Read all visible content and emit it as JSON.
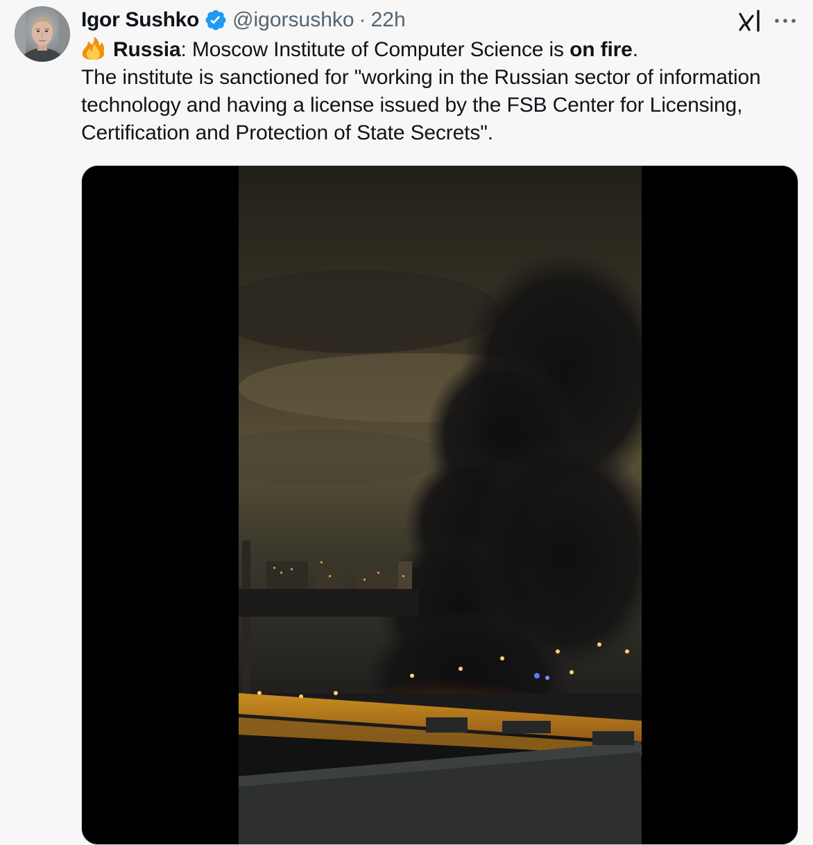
{
  "tweet": {
    "author": {
      "display_name": "Igor Sushko",
      "handle": "@igorsushko",
      "separator": "·",
      "time": "22h",
      "verified": true,
      "avatar_icon": "avatar-photo"
    },
    "actions": {
      "grok_icon": "grok-icon",
      "more_icon": "more-dots-icon"
    },
    "text": {
      "emoji": "fire-emoji",
      "location_bold": "Russia",
      "line1_rest": ": Moscow Institute of Computer Science is ",
      "line1_bold2": "on fire",
      "line1_end": ".",
      "line2": "The institute is sanctioned for \"working in the Russian sector of information",
      "line3": "technology and having a license issued by the FSB Center for Licensing,",
      "line4": "Certification and Protection of State Secrets\"."
    },
    "media": {
      "type": "video",
      "thumbnail": "night-city-fire-smoke"
    },
    "colors": {
      "text": "#0f1419",
      "secondary": "#536471",
      "verified": "#1d9bf0",
      "background": "#f7f7f7"
    }
  }
}
